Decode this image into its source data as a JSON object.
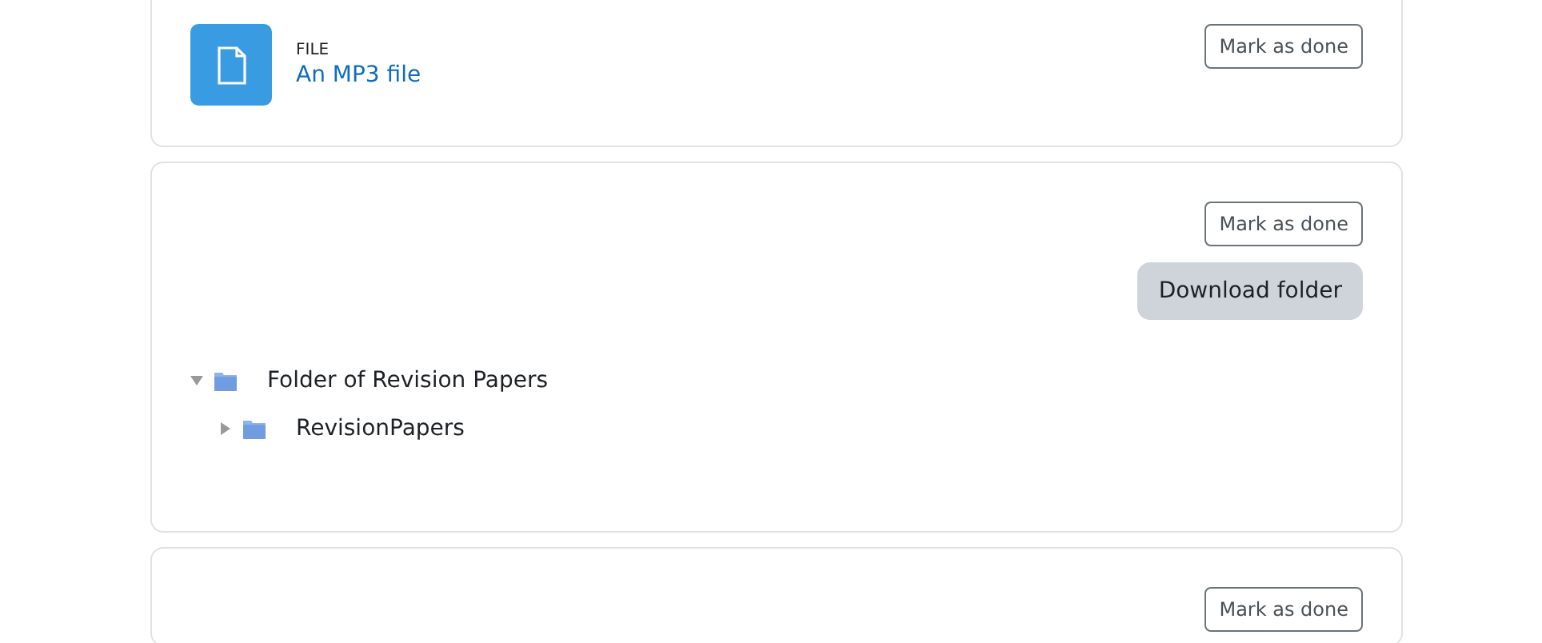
{
  "activities": [
    {
      "kind": "file",
      "type_label": "FILE",
      "title": "An MP3 file",
      "button": "Mark as done"
    },
    {
      "kind": "folder",
      "button": "Mark as done",
      "download": "Download folder",
      "tree": [
        {
          "name": "Folder of Revision Papers",
          "expanded": true,
          "children": [
            {
              "name": "RevisionPapers",
              "expanded": false
            }
          ]
        }
      ]
    },
    {
      "kind": "empty",
      "button": "Mark as done"
    }
  ]
}
